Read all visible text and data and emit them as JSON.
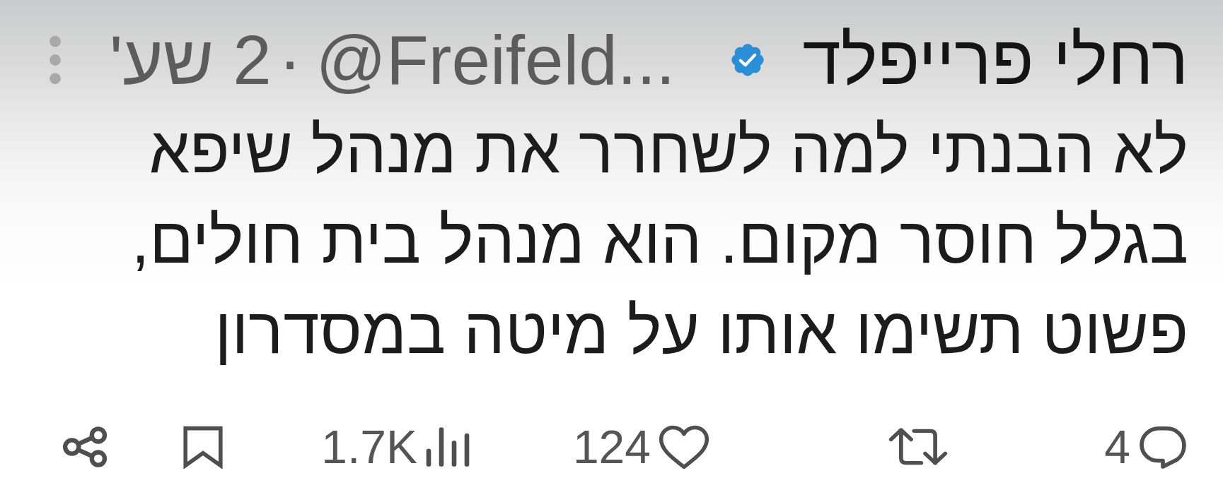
{
  "tweet": {
    "author": {
      "name": "רחלי פרייפלד",
      "verified": true,
      "handle": "@Freifeld...",
      "separator": "·",
      "time": "2 שע'"
    },
    "text": "לא הבנתי למה לשחרר את מנהל שיפא בגלל חוסר מקום. הוא מנהל בית חולים, פשוט תשימו אותו על מיטה במסדרון"
  },
  "actions": [
    {
      "kind": "reply",
      "count": "4"
    },
    {
      "kind": "repost"
    },
    {
      "kind": "like",
      "count": "124"
    },
    {
      "kind": "views",
      "count": "1.7K"
    },
    {
      "kind": "bookmark"
    },
    {
      "kind": "share"
    }
  ]
}
